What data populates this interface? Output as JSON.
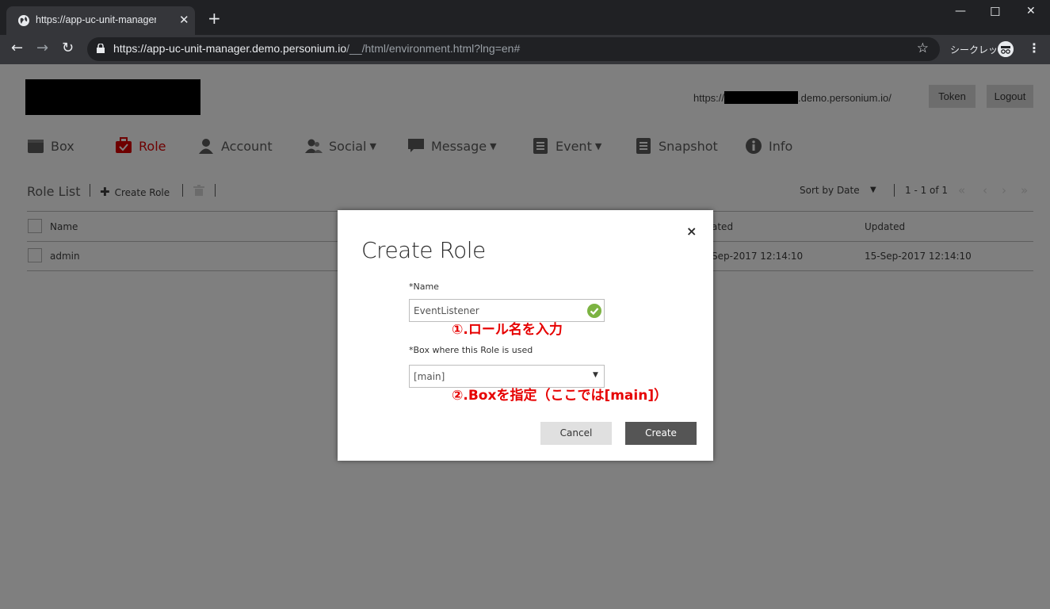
{
  "browser": {
    "tab_title": "https://app-uc-unit-manager.demo.personium.io/__/html/environment.html?lng=en#",
    "url_main": "https://app-uc-unit-manager.demo.personium.io",
    "url_rest": "/__/html/environment.html?lng=en#",
    "incognito_label": "シークレット",
    "new_tab": "+",
    "close_tab": "✕",
    "minimize": "—",
    "maximize": "☐",
    "close_window": "✕"
  },
  "header": {
    "unit_url_prefix": "https://",
    "unit_url_suffix": ".demo.personium.io/",
    "token_label": "Token",
    "logout_label": "Logout"
  },
  "menu": {
    "box": "Box",
    "role": "Role",
    "account": "Account",
    "social": "Social",
    "message": "Message",
    "event": "Event",
    "snapshot": "Snapshot",
    "info": "Info",
    "active_color": "#6e0000"
  },
  "rolebar": {
    "title": "Role List",
    "create_label": "Create Role",
    "sort_label": "Sort by Date",
    "count": "1 - 1 of 1"
  },
  "table": {
    "headers": {
      "name": "Name",
      "created": "ated",
      "updated": "Updated"
    },
    "rows": [
      {
        "name": "admin",
        "created": "Sep-2017 12:14:10",
        "updated": "15-Sep-2017 12:14:10"
      }
    ]
  },
  "modal": {
    "title": "Create Role",
    "close": "×",
    "name_label": "*Name",
    "name_value": "EventListener",
    "box_label": "*Box where this Role is used",
    "box_value": "[main]",
    "note1": "①.ロール名を入力",
    "note2": "②.Boxを指定（ここでは[main]）",
    "cancel_label": "Cancel",
    "create_label": "Create"
  }
}
